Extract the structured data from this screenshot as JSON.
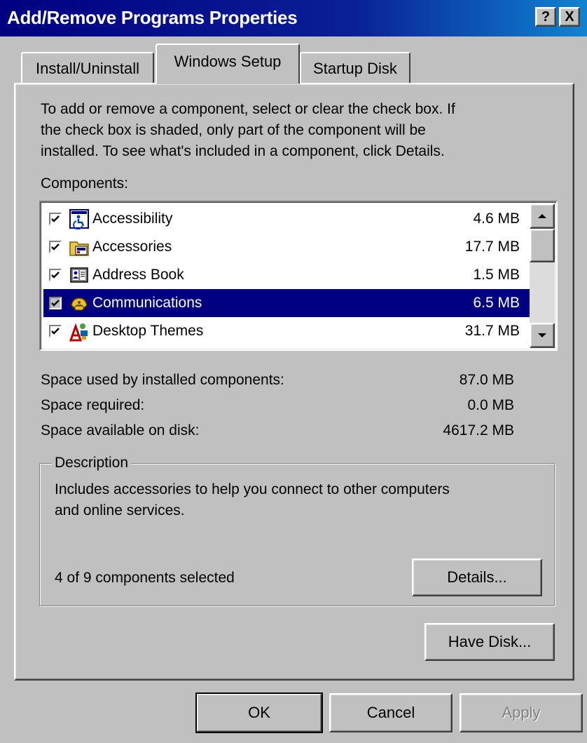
{
  "window": {
    "title": "Add/Remove Programs Properties",
    "help_label": "?",
    "close_label": "X"
  },
  "tabs": [
    {
      "label": "Install/Uninstall",
      "active": false
    },
    {
      "label": "Windows Setup",
      "active": true
    },
    {
      "label": "Startup Disk",
      "active": false
    }
  ],
  "instructions": {
    "line1": "To add or remove a component, select or clear the check box. If",
    "line2": "the check box is shaded, only part of the component will be",
    "line3": "installed. To see what's included in a component, click Details."
  },
  "components_label": "Components:",
  "components": [
    {
      "name": "Accessibility",
      "size": "4.6 MB",
      "checked": true,
      "selected": false,
      "icon": "accessibility-icon"
    },
    {
      "name": "Accessories",
      "size": "17.7 MB",
      "checked": true,
      "selected": false,
      "icon": "accessories-icon"
    },
    {
      "name": "Address Book",
      "size": "1.5 MB",
      "checked": true,
      "selected": false,
      "icon": "address-book-icon"
    },
    {
      "name": "Communications",
      "size": "6.5 MB",
      "checked": true,
      "selected": true,
      "icon": "communications-icon"
    },
    {
      "name": "Desktop Themes",
      "size": "31.7 MB",
      "checked": true,
      "selected": false,
      "icon": "desktop-themes-icon"
    }
  ],
  "space": {
    "used_label": "Space used by installed components:",
    "used_value": "87.0 MB",
    "required_label": "Space required:",
    "required_value": "0.0 MB",
    "available_label": "Space available on disk:",
    "available_value": "4617.2 MB"
  },
  "description": {
    "legend": "Description",
    "line1": "Includes accessories to help you connect to other computers",
    "line2": "and online services.",
    "selected_count": "4 of 9 components selected",
    "details_button": "Details..."
  },
  "have_disk_button": "Have Disk...",
  "footer": {
    "ok": "OK",
    "cancel": "Cancel",
    "apply": "Apply"
  },
  "colors": {
    "titlebar": "#000080",
    "selection": "#000080",
    "face": "#c0c0c0"
  }
}
